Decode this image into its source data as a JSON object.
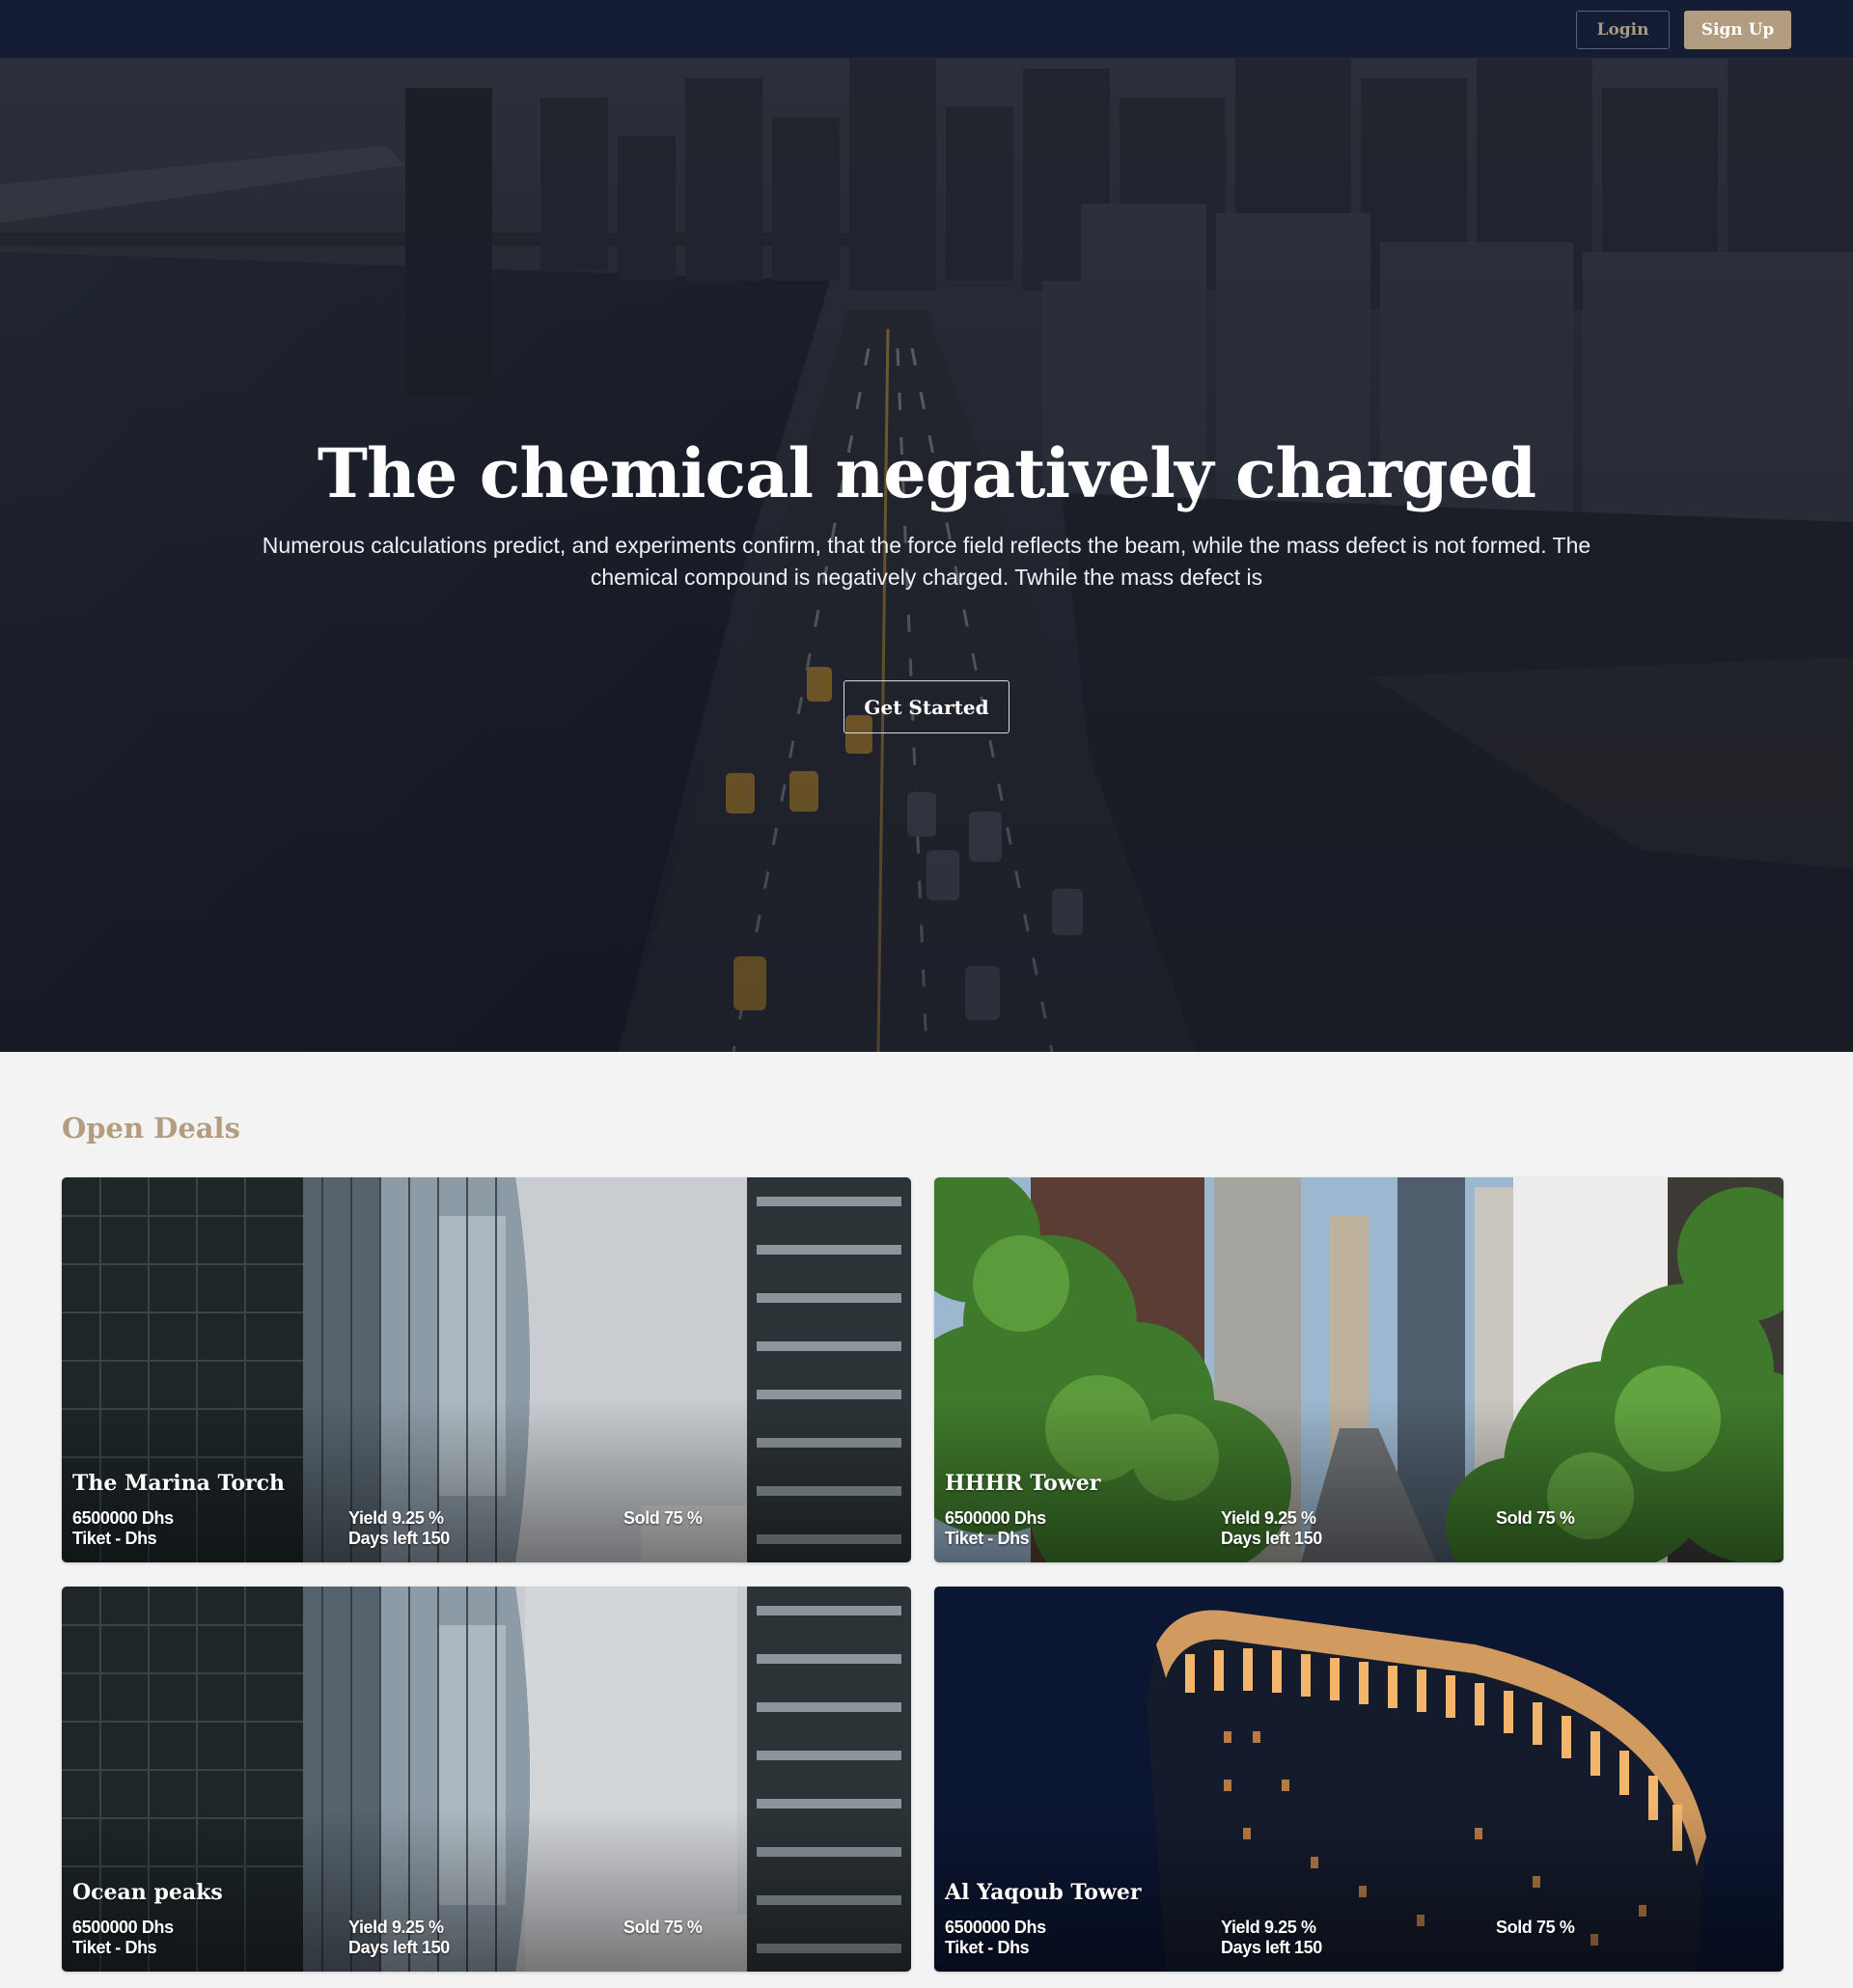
{
  "nav": {
    "login_label": "Login",
    "signup_label": "Sign Up"
  },
  "hero": {
    "title": "The chemical negatively charged",
    "subtitle": "Numerous calculations predict, and experiments confirm, that the force field reflects the beam, while the mass defect is not formed. The chemical compound is negatively charged. Twhile the mass defect is",
    "cta_label": "Get Started"
  },
  "deals": {
    "section_title": "Open Deals",
    "items": [
      {
        "name": "The Marina Torch",
        "price": "6500000 Dhs",
        "ticket": "Tiket - Dhs",
        "yield": "Yield 9.25 %",
        "days_left": "Days left 150",
        "sold": "Sold 75 %"
      },
      {
        "name": "HHHR Tower",
        "price": "6500000 Dhs",
        "ticket": "Tiket - Dhs",
        "yield": "Yield 9.25 %",
        "days_left": "Days left 150",
        "sold": "Sold 75 %"
      },
      {
        "name": "Ocean peaks",
        "price": "6500000 Dhs",
        "ticket": "Tiket - Dhs",
        "yield": "Yield 9.25 %",
        "days_left": "Days left 150",
        "sold": "Sold 75 %"
      },
      {
        "name": "Al Yaqoub Tower",
        "price": "6500000 Dhs",
        "ticket": "Tiket - Dhs",
        "yield": "Yield 9.25 %",
        "days_left": "Days left 150",
        "sold": "Sold 75 %"
      }
    ]
  },
  "colors": {
    "nav_background": "#141d33",
    "accent": "#b29d80",
    "page_background": "#f3f3f3"
  }
}
